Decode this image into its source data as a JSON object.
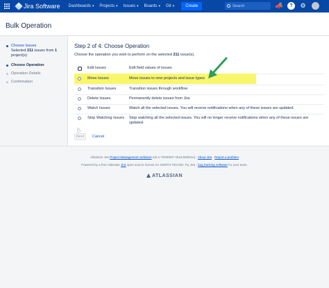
{
  "topbar": {
    "logo": "Jira Software",
    "nav": [
      {
        "label": "Dashboards"
      },
      {
        "label": "Projects"
      },
      {
        "label": "Issues"
      },
      {
        "label": "Boards"
      },
      {
        "label": "Git"
      }
    ],
    "create_label": "Create",
    "search_placeholder": "Search",
    "accent_color": "#0747a6"
  },
  "header": {
    "title": "Bulk Operation"
  },
  "sidebar": {
    "step1_label": "Choose Issues",
    "step1_sub_line1_pre": "Selected ",
    "step1_sub_count": "211",
    "step1_sub_line1_post": " issues from ",
    "step1_sub_projects": "1",
    "step1_sub_line2": "project(s)",
    "step2_label": "Choose Operation",
    "step3_label": "Operation Details",
    "step4_label": "Confirmation"
  },
  "main": {
    "heading": "Step 2 of 4: Choose Operation",
    "instr_pre": "Choose the operation you wish to perform on the selected ",
    "instr_count": "211",
    "instr_post": " issue(s).",
    "operations": [
      {
        "name": "Edit Issues",
        "desc": "Edit field values of issues"
      },
      {
        "name": "Move Issues",
        "desc": "Move issues to new projects and issue types"
      },
      {
        "name": "Transition Issues",
        "desc": "Transition issues through workflow"
      },
      {
        "name": "Delete Issues",
        "desc": "Permanently delete issues from Jira"
      },
      {
        "name": "Watch Issues",
        "desc": "Watch all the selected issues. You will receive notifications when any of these issues are updated."
      },
      {
        "name": "Stop Watching Issues",
        "desc": "Stop watching all the selected issues. You will no longer receive notifications when any of these issues are updated."
      }
    ],
    "next_label": "Next",
    "cancel_label": "Cancel",
    "highlight_color": "#f8f66b"
  },
  "footer": {
    "line1_pre": "Atlassian Jira ",
    "line1_link": "Project Management Software",
    "line1_version": " (v9.4.7#940007-sha1:b66f4ce)",
    "line1_sep1": " · ",
    "line1_about": "About Jira",
    "line1_sep2": " · ",
    "line1_report": "Report a problem",
    "line2_pre": "Powered by a free Atlassian ",
    "line2_jira": "Jira",
    "line2_mid": " open source license for NORTH TECOM. Try Jira - ",
    "line2_link": "bug tracking software",
    "line2_post": " for your team.",
    "brand": "ATLASSIAN"
  }
}
